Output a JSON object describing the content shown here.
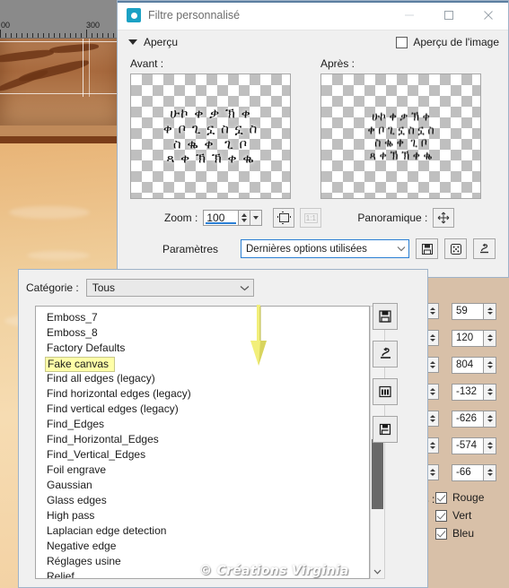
{
  "window": {
    "title": "Filtre personnalisé",
    "icon": "camera-icon",
    "minimize": "—",
    "maximize": "□",
    "close": "✕"
  },
  "preview_section": {
    "collapse_label": "Aperçu",
    "image_preview_label": "Aperçu de l'image",
    "image_preview_checked": false,
    "before_label": "Avant :",
    "after_label": "Après :",
    "before_glyphs": "ሁኮ ቀ ቃ ኽ ቀ\nቀ ቦ ጊ ኗ ስ ኗ ስ\nስ ቈ ቀ  ጊ ቦ\nጻ ቀ ኽ ኽ ቀ ቈ",
    "after_glyphs": "ሁኮ ቀ ቃ ኽ ቀ\nቀ ቦ ጊ ኗ ስ ኗ ስ\nስ ቈ ቀ  ጊ ቦ\nጻ ቀ ኽ ኽ ቀ ቈ"
  },
  "zoom": {
    "label": "Zoom :",
    "value": "100",
    "fit_icon": "fit-to-window-icon",
    "actual_size_icon": "one-to-one-icon",
    "actual_size_text": "1:1",
    "pan_label": "Panoramique :",
    "pan_icon": "move-icon"
  },
  "parameters": {
    "label": "Paramètres",
    "selected": "Dernières options utilisées",
    "save_icon": "floppy-disk-icon",
    "randomize_icon": "dice-icon",
    "reset_icon": "reset-stamp-icon"
  },
  "category": {
    "label": "Catégorie :",
    "selected": "Tous"
  },
  "filter_list": {
    "items": [
      "Emboss_7",
      "Emboss_8",
      "Factory Defaults",
      "Fake canvas",
      "Find all edges (legacy)",
      "Find horizontal edges (legacy)",
      "Find vertical edges (legacy)",
      "Find_Edges",
      "Find_Horizontal_Edges",
      "Find_Vertical_Edges",
      "Foil engrave",
      "Gaussian",
      "Glass edges",
      "High pass",
      "Laplacian edge detection",
      "Negative edge",
      "Réglages usine",
      "Relief"
    ],
    "selected_index": 3,
    "highlight_color": "#ffffa8"
  },
  "side_buttons": [
    {
      "name": "save-preset-button",
      "icon": "floppy-disk-icon"
    },
    {
      "name": "reset-preset-button",
      "icon": "reset-stamp-icon"
    },
    {
      "name": "delete-preset-button",
      "icon": "bank-icon"
    },
    {
      "name": "save-as-preset-button",
      "icon": "save-as-icon"
    }
  ],
  "matrix_values": [
    "59",
    "120",
    "804",
    "-132",
    "-626",
    "-574",
    "-66"
  ],
  "channels": {
    "prefix_label": "es :",
    "items": [
      {
        "label": "Rouge",
        "checked": true
      },
      {
        "label": "Vert",
        "checked": true
      },
      {
        "label": "Bleu",
        "checked": true
      }
    ]
  },
  "ruler": {
    "labels": [
      "00",
      "300"
    ]
  },
  "annotation": {
    "arrow_color": "#f2ef7a",
    "direction": "down"
  },
  "watermark": "© Créations Virginia"
}
